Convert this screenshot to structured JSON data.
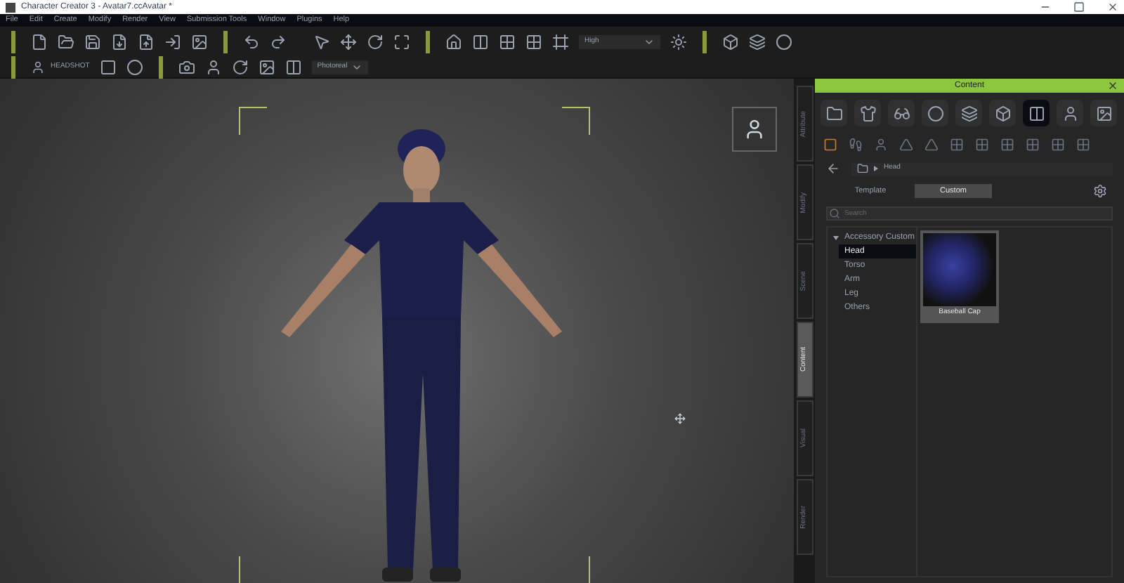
{
  "window": {
    "title": "Character Creator 3 - Avatar7.ccAvatar *"
  },
  "menu": [
    "File",
    "Edit",
    "Create",
    "Modify",
    "Render",
    "View",
    "Submission Tools",
    "Window",
    "Plugins",
    "Help"
  ],
  "toolbar": {
    "quality": "High",
    "headshot": "HEADSHOT",
    "render_mode": "Photoreal"
  },
  "side_tabs": [
    {
      "label": "Attribute",
      "selected": false
    },
    {
      "label": "Modify",
      "selected": false
    },
    {
      "label": "Scene",
      "selected": false
    },
    {
      "label": "Content",
      "selected": true
    },
    {
      "label": "Visual",
      "selected": false
    },
    {
      "label": "Render",
      "selected": false
    }
  ],
  "content_panel": {
    "title": "Content",
    "breadcrumb": "Head",
    "tabs": [
      {
        "label": "Template",
        "selected": false
      },
      {
        "label": "Custom",
        "selected": true
      }
    ],
    "search": {
      "placeholder": "Search"
    },
    "tree": [
      {
        "label": "Accessory Custom",
        "expanded": true,
        "selected": false,
        "children": [
          {
            "label": "Head",
            "selected": true
          },
          {
            "label": "Torso",
            "selected": false
          },
          {
            "label": "Arm",
            "selected": false
          },
          {
            "label": "Leg",
            "selected": false
          },
          {
            "label": "Others",
            "selected": false
          }
        ]
      }
    ],
    "items": [
      {
        "label": "Baseball Cap"
      }
    ]
  }
}
